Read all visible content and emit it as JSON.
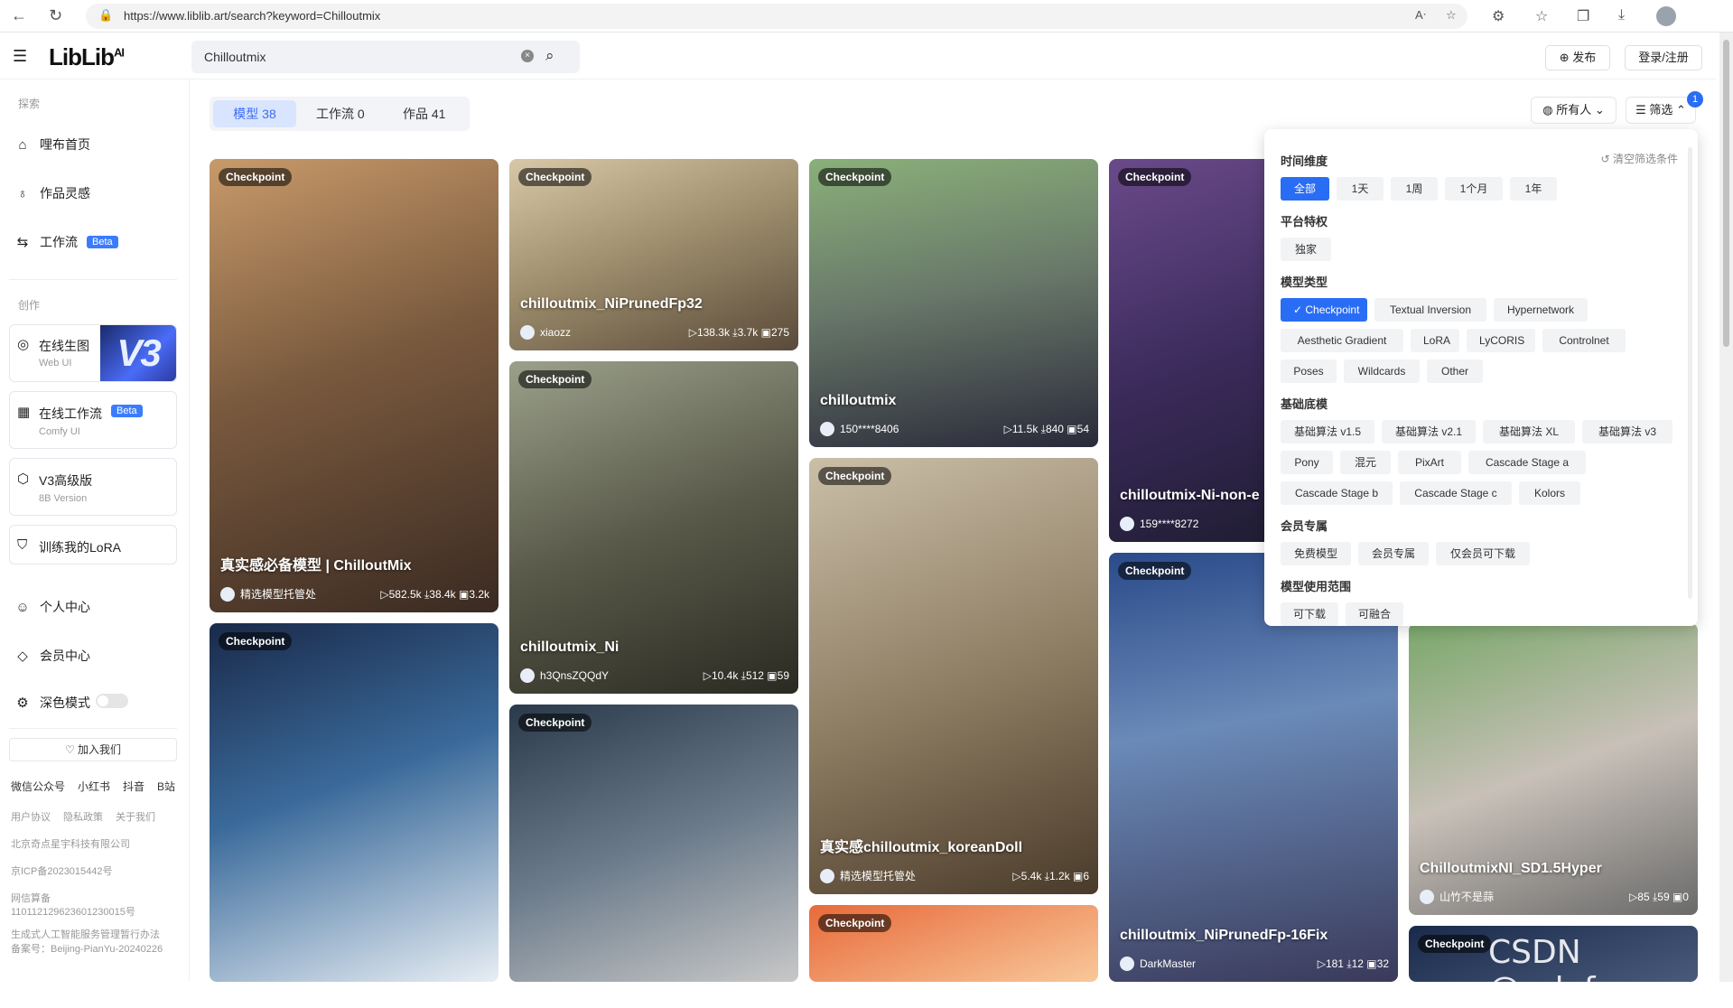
{
  "browser": {
    "url": "https://www.liblib.art/search?keyword=Chilloutmix"
  },
  "header": {
    "logo": "LibLib",
    "logo_sup": "AI",
    "search_value": "Chilloutmix",
    "publish": "发布",
    "login": "登录/注册"
  },
  "sidebar": {
    "section_explore": "探索",
    "section_create": "创作",
    "items": {
      "home": "哩布首页",
      "inspiration": "作品灵感",
      "workflow": "工作流",
      "personal": "个人中心",
      "vip": "会员中心",
      "dark": "深色模式"
    },
    "beta": "Beta",
    "cards": {
      "online_gen": {
        "title": "在线生图",
        "sub": "Web UI",
        "badge": "V3"
      },
      "online_flow": {
        "title": "在线工作流",
        "sub": "Comfy UI"
      },
      "v3_adv": {
        "title": "V3高级版",
        "sub": "8B Version"
      },
      "train": {
        "title": "训练我的LoRA"
      }
    },
    "join": "加入我们",
    "social": [
      "微信公众号",
      "小红书",
      "抖音",
      "B站"
    ],
    "links": [
      "用户协议",
      "隐私政策",
      "关于我们"
    ],
    "company": "北京奇点星宇科技有限公司",
    "icp": "京ICP备2023015442号",
    "record": "网信算备110112129623601230015号",
    "genai": "生成式人工智能服务管理暂行办法",
    "record2": "备案号：Beijing-PianYu-20240226"
  },
  "tabs": [
    {
      "label": "模型 38"
    },
    {
      "label": "工作流 0"
    },
    {
      "label": "作品 41"
    }
  ],
  "owner_filter": "所有人",
  "filter_btn": "筛选",
  "filter_badge": "1",
  "filter_panel": {
    "clear": "清空筛选条件",
    "time": {
      "title": "时间维度",
      "options": [
        "全部",
        "1天",
        "1周",
        "1个月",
        "1年"
      ]
    },
    "privilege": {
      "title": "平台特权",
      "options": [
        "独家"
      ]
    },
    "model_type": {
      "title": "模型类型",
      "options": [
        "Checkpoint",
        "Textual Inversion",
        "Hypernetwork",
        "Aesthetic Gradient",
        "LoRA",
        "LyCORIS",
        "Controlnet",
        "Poses",
        "Wildcards",
        "Other"
      ]
    },
    "base": {
      "title": "基础底模",
      "options": [
        "基础算法 v1.5",
        "基础算法 v2.1",
        "基础算法 XL",
        "基础算法 v3",
        "Pony",
        "混元",
        "PixArt",
        "Cascade Stage a",
        "Cascade Stage b",
        "Cascade Stage c",
        "Kolors"
      ]
    },
    "member": {
      "title": "会员专属",
      "options": [
        "免费模型",
        "会员专属",
        "仅会员可下载"
      ]
    },
    "usage": {
      "title": "模型使用范围",
      "options": [
        "可下载",
        "可融合"
      ]
    }
  },
  "cards": [
    {
      "tag": "Checkpoint",
      "title": "真实感必备模型 | ChilloutMix",
      "author": "精选模型托管处",
      "stats": "▷582.5k ⤓38.4k ▣3.2k"
    },
    {
      "tag": "Checkpoint",
      "title": "chilloutmix_NiPrunedFp32",
      "author": "xiaozz",
      "stats": "▷138.3k ⤓3.7k ▣275"
    },
    {
      "tag": "Checkpoint",
      "title": "chilloutmix",
      "author": "150****8406",
      "stats": "▷11.5k ⤓840 ▣54"
    },
    {
      "tag": "Checkpoint",
      "title": "chilloutmix-Ni-non-e",
      "author": "159****8272",
      "stats": ""
    },
    {
      "tag": "Checkpoint",
      "title": "",
      "author": "",
      "stats": ""
    },
    {
      "tag": "Checkpoint",
      "title": "chilloutmix_Ni",
      "author": "h3QnsZQQdY",
      "stats": "▷10.4k ⤓512 ▣59"
    },
    {
      "tag": "Checkpoint",
      "title": "真实感chilloutmix_koreanDoll",
      "author": "精选模型托管处",
      "stats": "▷5.4k ⤓1.2k ▣6"
    },
    {
      "tag": "Checkpoint",
      "title": "chilloutmix_NiPrunedFp-16Fix",
      "author": "DarkMaster",
      "stats": "▷181 ⤓12 ▣32"
    },
    {
      "tag": "Checkpoint",
      "title": "ChilloutmixNI_SD1.5Hyper",
      "author": "山竹不是蒜",
      "stats": "▷85 ⤓59 ▣0"
    },
    {
      "tag": "Checkpoint",
      "title": "",
      "author": "",
      "stats": ""
    },
    {
      "tag": "Checkpoint",
      "title": "",
      "author": "",
      "stats": ""
    },
    {
      "tag": "Checkpoint",
      "title": "",
      "author": "",
      "stats": ""
    }
  ],
  "watermark": "CSDN @zslefour"
}
